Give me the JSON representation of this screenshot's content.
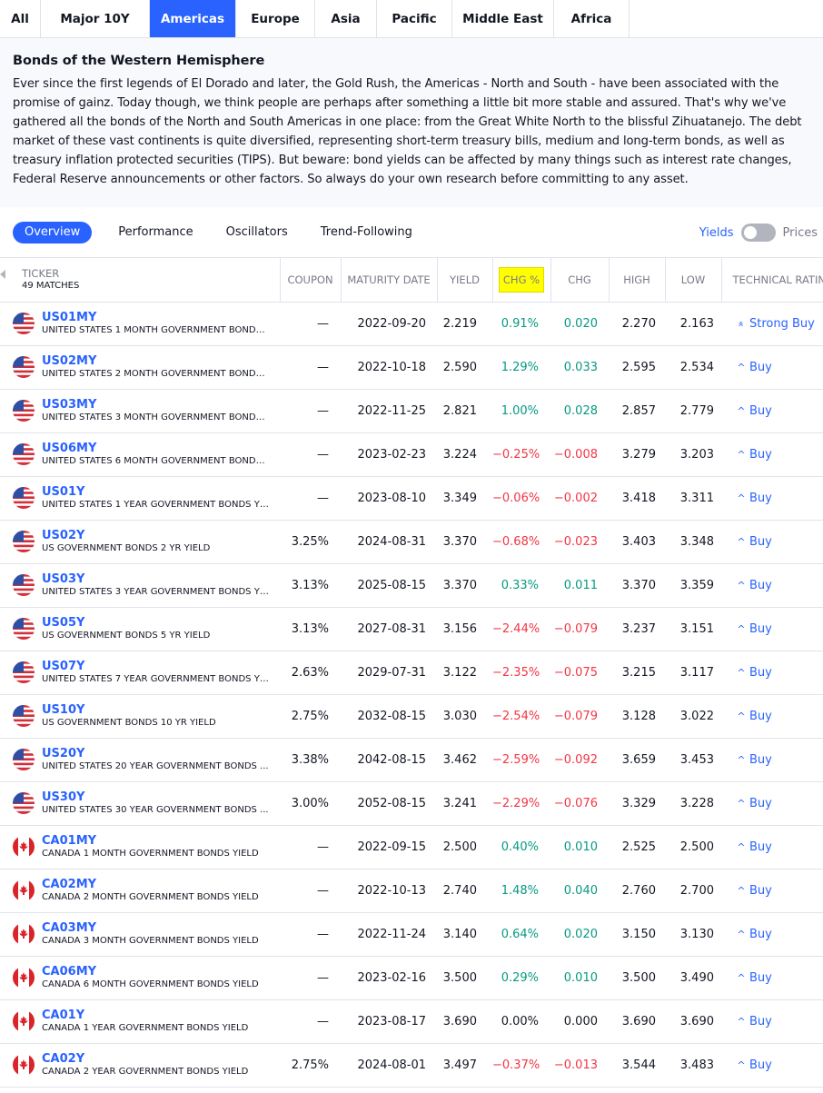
{
  "region_tabs": [
    {
      "label": "All",
      "active": false
    },
    {
      "label": "Major 10Y",
      "active": false
    },
    {
      "label": "Americas",
      "active": true
    },
    {
      "label": "Europe",
      "active": false
    },
    {
      "label": "Asia",
      "active": false
    },
    {
      "label": "Pacific",
      "active": false
    },
    {
      "label": "Middle East",
      "active": false
    },
    {
      "label": "Africa",
      "active": false
    }
  ],
  "intro": {
    "title": "Bonds of the Western Hemisphere",
    "body": "Ever since the first legends of El Dorado and later, the Gold Rush, the Americas - North and South - have been associated with the promise of gainz. Today though, we think people are perhaps after something a little bit more stable and assured. That's why we've gathered all the bonds of the North and South Americas in one place: from the Great White North to the blissful Zihuatanejo. The debt market of these vast continents is quite diversified, representing short-term treasury bills, medium and long-term bonds, as well as treasury inflation protected securities (TIPS). But beware: bond yields can be affected by many things such as interest rate changes, Federal Reserve announcements or other factors. So always do your own research before committing to any asset."
  },
  "view_tabs": [
    {
      "label": "Overview",
      "active": true
    },
    {
      "label": "Performance",
      "active": false
    },
    {
      "label": "Oscillators",
      "active": false
    },
    {
      "label": "Trend-Following",
      "active": false
    }
  ],
  "toggle": {
    "left": "Yields",
    "right": "Prices"
  },
  "columns": {
    "ticker": "TICKER",
    "matches": "49 MATCHES",
    "coupon": "COUPON",
    "maturity": "MATURITY DATE",
    "yield": "YIELD",
    "chg_pct": "CHG %",
    "chg": "CHG",
    "high": "HIGH",
    "low": "LOW",
    "rating": "TECHNICAL RATING"
  },
  "colors": {
    "accent": "#2962ff",
    "positive": "#089981",
    "negative": "#f23645",
    "highlight": "#ffff00"
  },
  "rows": [
    {
      "flag": "us",
      "symbol": "US01MY",
      "name": "UNITED STATES 1 MONTH GOVERNMENT BONDS...",
      "coupon": "—",
      "maturity": "2022-09-20",
      "yield": "2.219",
      "chg_pct": "0.91%",
      "chg": "0.020",
      "high": "2.270",
      "low": "2.163",
      "dir": "pos",
      "rating": "Strong Buy",
      "rating_icon": "double-chevron-up-icon"
    },
    {
      "flag": "us",
      "symbol": "US02MY",
      "name": "UNITED STATES 2 MONTH GOVERNMENT BONDS...",
      "coupon": "—",
      "maturity": "2022-10-18",
      "yield": "2.590",
      "chg_pct": "1.29%",
      "chg": "0.033",
      "high": "2.595",
      "low": "2.534",
      "dir": "pos",
      "rating": "Buy",
      "rating_icon": "chevron-up-icon"
    },
    {
      "flag": "us",
      "symbol": "US03MY",
      "name": "UNITED STATES 3 MONTH GOVERNMENT BONDS...",
      "coupon": "—",
      "maturity": "2022-11-25",
      "yield": "2.821",
      "chg_pct": "1.00%",
      "chg": "0.028",
      "high": "2.857",
      "low": "2.779",
      "dir": "pos",
      "rating": "Buy",
      "rating_icon": "chevron-up-icon"
    },
    {
      "flag": "us",
      "symbol": "US06MY",
      "name": "UNITED STATES 6 MONTH GOVERNMENT BONDS...",
      "coupon": "—",
      "maturity": "2023-02-23",
      "yield": "3.224",
      "chg_pct": "−0.25%",
      "chg": "−0.008",
      "high": "3.279",
      "low": "3.203",
      "dir": "neg",
      "rating": "Buy",
      "rating_icon": "chevron-up-icon"
    },
    {
      "flag": "us",
      "symbol": "US01Y",
      "name": "UNITED STATES 1 YEAR GOVERNMENT BONDS YI...",
      "coupon": "—",
      "maturity": "2023-08-10",
      "yield": "3.349",
      "chg_pct": "−0.06%",
      "chg": "−0.002",
      "high": "3.418",
      "low": "3.311",
      "dir": "neg",
      "rating": "Buy",
      "rating_icon": "chevron-up-icon"
    },
    {
      "flag": "us",
      "symbol": "US02Y",
      "name": "US GOVERNMENT BONDS 2 YR YIELD",
      "coupon": "3.25%",
      "maturity": "2024-08-31",
      "yield": "3.370",
      "chg_pct": "−0.68%",
      "chg": "−0.023",
      "high": "3.403",
      "low": "3.348",
      "dir": "neg",
      "rating": "Buy",
      "rating_icon": "chevron-up-icon"
    },
    {
      "flag": "us",
      "symbol": "US03Y",
      "name": "UNITED STATES 3 YEAR GOVERNMENT BONDS YI...",
      "coupon": "3.13%",
      "maturity": "2025-08-15",
      "yield": "3.370",
      "chg_pct": "0.33%",
      "chg": "0.011",
      "high": "3.370",
      "low": "3.359",
      "dir": "pos",
      "rating": "Buy",
      "rating_icon": "chevron-up-icon"
    },
    {
      "flag": "us",
      "symbol": "US05Y",
      "name": "US GOVERNMENT BONDS 5 YR YIELD",
      "coupon": "3.13%",
      "maturity": "2027-08-31",
      "yield": "3.156",
      "chg_pct": "−2.44%",
      "chg": "−0.079",
      "high": "3.237",
      "low": "3.151",
      "dir": "neg",
      "rating": "Buy",
      "rating_icon": "chevron-up-icon"
    },
    {
      "flag": "us",
      "symbol": "US07Y",
      "name": "UNITED STATES 7 YEAR GOVERNMENT BONDS YI...",
      "coupon": "2.63%",
      "maturity": "2029-07-31",
      "yield": "3.122",
      "chg_pct": "−2.35%",
      "chg": "−0.075",
      "high": "3.215",
      "low": "3.117",
      "dir": "neg",
      "rating": "Buy",
      "rating_icon": "chevron-up-icon"
    },
    {
      "flag": "us",
      "symbol": "US10Y",
      "name": "US GOVERNMENT BONDS 10 YR YIELD",
      "coupon": "2.75%",
      "maturity": "2032-08-15",
      "yield": "3.030",
      "chg_pct": "−2.54%",
      "chg": "−0.079",
      "high": "3.128",
      "low": "3.022",
      "dir": "neg",
      "rating": "Buy",
      "rating_icon": "chevron-up-icon"
    },
    {
      "flag": "us",
      "symbol": "US20Y",
      "name": "UNITED STATES 20 YEAR GOVERNMENT BONDS ...",
      "coupon": "3.38%",
      "maturity": "2042-08-15",
      "yield": "3.462",
      "chg_pct": "−2.59%",
      "chg": "−0.092",
      "high": "3.659",
      "low": "3.453",
      "dir": "neg",
      "rating": "Buy",
      "rating_icon": "chevron-up-icon"
    },
    {
      "flag": "us",
      "symbol": "US30Y",
      "name": "UNITED STATES 30 YEAR GOVERNMENT BONDS ...",
      "coupon": "3.00%",
      "maturity": "2052-08-15",
      "yield": "3.241",
      "chg_pct": "−2.29%",
      "chg": "−0.076",
      "high": "3.329",
      "low": "3.228",
      "dir": "neg",
      "rating": "Buy",
      "rating_icon": "chevron-up-icon"
    },
    {
      "flag": "ca",
      "symbol": "CA01MY",
      "name": "CANADA 1 MONTH GOVERNMENT BONDS YIELD",
      "coupon": "—",
      "maturity": "2022-09-15",
      "yield": "2.500",
      "chg_pct": "0.40%",
      "chg": "0.010",
      "high": "2.525",
      "low": "2.500",
      "dir": "pos",
      "rating": "Buy",
      "rating_icon": "chevron-up-icon"
    },
    {
      "flag": "ca",
      "symbol": "CA02MY",
      "name": "CANADA 2 MONTH GOVERNMENT BONDS YIELD",
      "coupon": "—",
      "maturity": "2022-10-13",
      "yield": "2.740",
      "chg_pct": "1.48%",
      "chg": "0.040",
      "high": "2.760",
      "low": "2.700",
      "dir": "pos",
      "rating": "Buy",
      "rating_icon": "chevron-up-icon"
    },
    {
      "flag": "ca",
      "symbol": "CA03MY",
      "name": "CANADA 3 MONTH GOVERNMENT BONDS YIELD",
      "coupon": "—",
      "maturity": "2022-11-24",
      "yield": "3.140",
      "chg_pct": "0.64%",
      "chg": "0.020",
      "high": "3.150",
      "low": "3.130",
      "dir": "pos",
      "rating": "Buy",
      "rating_icon": "chevron-up-icon"
    },
    {
      "flag": "ca",
      "symbol": "CA06MY",
      "name": "CANADA 6 MONTH GOVERNMENT BONDS YIELD",
      "coupon": "—",
      "maturity": "2023-02-16",
      "yield": "3.500",
      "chg_pct": "0.29%",
      "chg": "0.010",
      "high": "3.500",
      "low": "3.490",
      "dir": "pos",
      "rating": "Buy",
      "rating_icon": "chevron-up-icon"
    },
    {
      "flag": "ca",
      "symbol": "CA01Y",
      "name": "CANADA 1 YEAR GOVERNMENT BONDS YIELD",
      "coupon": "—",
      "maturity": "2023-08-17",
      "yield": "3.690",
      "chg_pct": "0.00%",
      "chg": "0.000",
      "high": "3.690",
      "low": "3.690",
      "dir": "flat",
      "rating": "Buy",
      "rating_icon": "chevron-up-icon"
    },
    {
      "flag": "ca",
      "symbol": "CA02Y",
      "name": "CANADA 2 YEAR GOVERNMENT BONDS YIELD",
      "coupon": "2.75%",
      "maturity": "2024-08-01",
      "yield": "3.497",
      "chg_pct": "−0.37%",
      "chg": "−0.013",
      "high": "3.544",
      "low": "3.483",
      "dir": "neg",
      "rating": "Buy",
      "rating_icon": "chevron-up-icon"
    }
  ]
}
